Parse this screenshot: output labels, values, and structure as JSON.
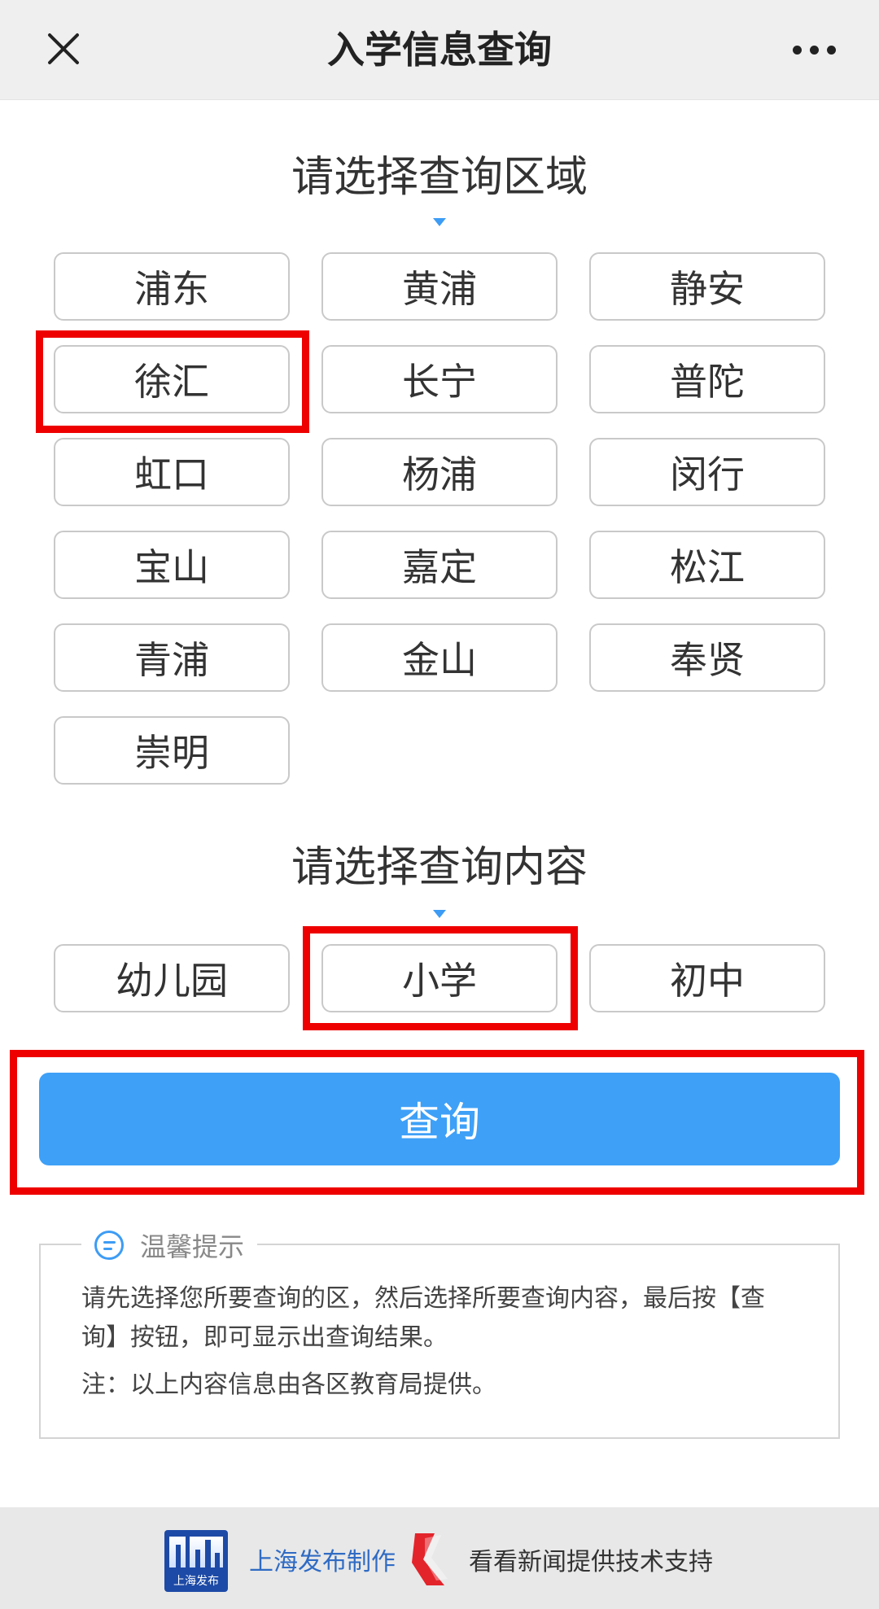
{
  "header": {
    "title": "入学信息查询",
    "close_icon": "close-icon",
    "more_icon": "more-dots-icon"
  },
  "district_section": {
    "title": "请选择查询区域",
    "options": [
      "浦东",
      "黄浦",
      "静安",
      "徐汇",
      "长宁",
      "普陀",
      "虹口",
      "杨浦",
      "闵行",
      "宝山",
      "嘉定",
      "松江",
      "青浦",
      "金山",
      "奉贤",
      "崇明"
    ],
    "selected": "徐汇"
  },
  "content_section": {
    "title": "请选择查询内容",
    "options": [
      "幼儿园",
      "小学",
      "初中"
    ],
    "selected": "小学"
  },
  "query_button": {
    "label": "查询"
  },
  "tips": {
    "title": "温馨提示",
    "text": "请先选择您所要查询的区，然后选择所要查询内容，最后按【查询】按钮，即可显示出查询结果。",
    "note": "注：以上内容信息由各区教育局提供。"
  },
  "footer": {
    "logo_text": "上海发布",
    "left_text": "上海发布制作",
    "right_text": "看看新闻提供技术支持"
  },
  "colors": {
    "accent": "#3ea0f7",
    "highlight": "#ee0000"
  }
}
